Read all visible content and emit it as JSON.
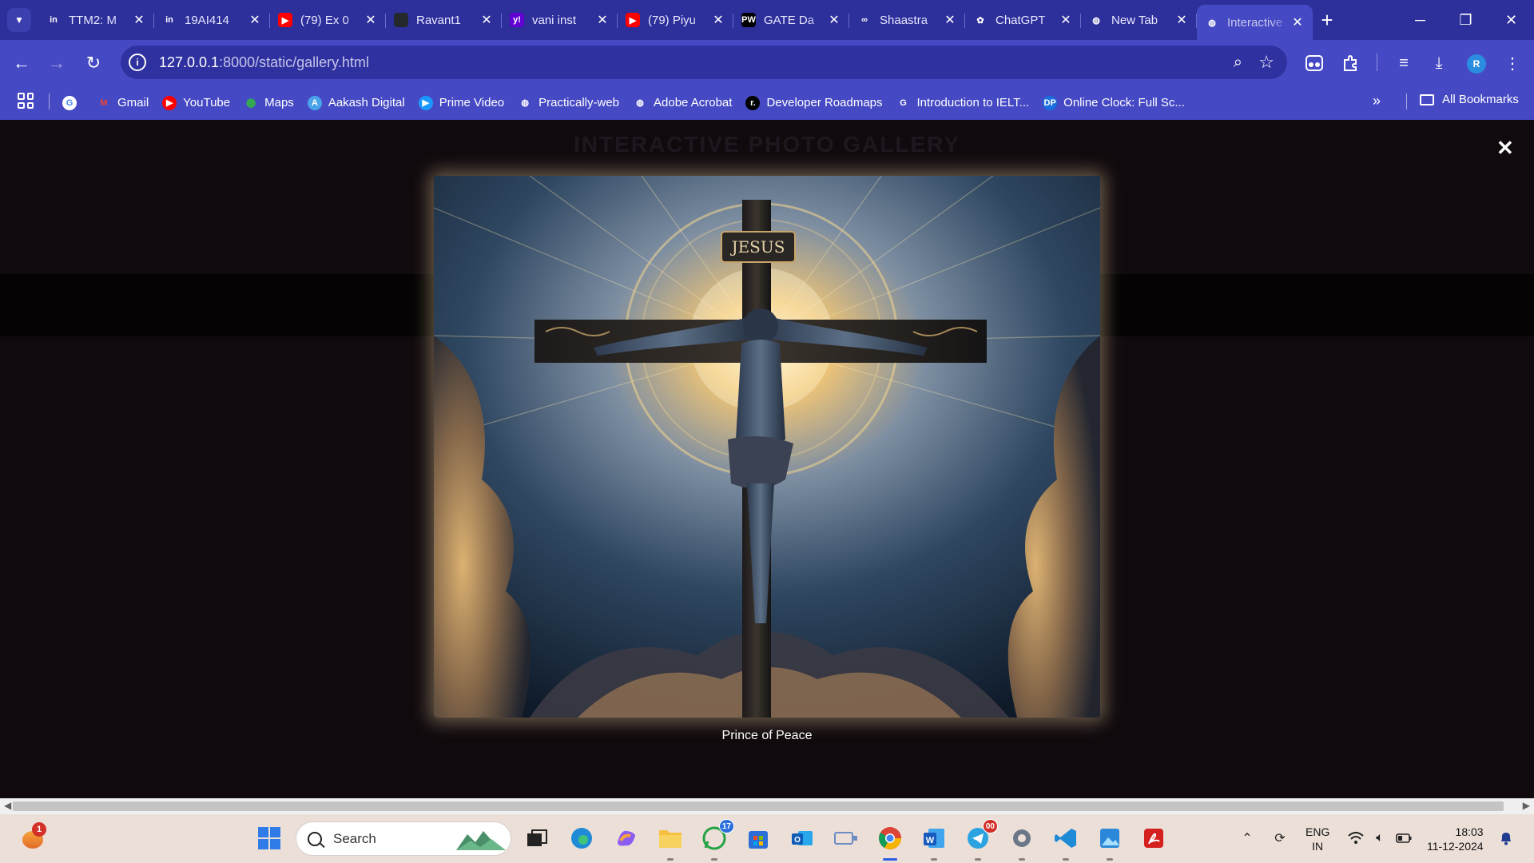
{
  "browser": {
    "tabs": [
      {
        "title": "TTM2: M",
        "favicon": "unstop-icon",
        "favicon_text": "in",
        "favicon_color": "#2d2f9a",
        "active": false
      },
      {
        "title": "19AI414",
        "favicon": "unstop-icon",
        "favicon_text": "in",
        "favicon_color": "#2d2f9a",
        "active": false
      },
      {
        "title": "(79) Ex 0",
        "favicon": "youtube-icon",
        "favicon_text": "▶",
        "favicon_color": "#ff0000",
        "active": false
      },
      {
        "title": "Ravant1",
        "favicon": "github-icon",
        "favicon_text": "",
        "favicon_color": "#24292e",
        "active": false
      },
      {
        "title": "vani inst",
        "favicon": "yahoo-icon",
        "favicon_text": "y!",
        "favicon_color": "#6001d2",
        "active": false
      },
      {
        "title": "(79) Piyu",
        "favicon": "youtube-icon",
        "favicon_text": "▶",
        "favicon_color": "#ff0000",
        "active": false
      },
      {
        "title": "GATE Da",
        "favicon": "pw-icon",
        "favicon_text": "PW",
        "favicon_color": "#000000",
        "active": false
      },
      {
        "title": "Shaastra",
        "favicon": "shaastra-icon",
        "favicon_text": "∞",
        "favicon_color": "#2d2f9a",
        "active": false
      },
      {
        "title": "ChatGPT",
        "favicon": "chatgpt-icon",
        "favicon_text": "✿",
        "favicon_color": "#2d2f9a",
        "active": false
      },
      {
        "title": "New Tab",
        "favicon": "globe-icon",
        "favicon_text": "◍",
        "favicon_color": "#2d2f9a",
        "active": false
      },
      {
        "title": "Interactive",
        "favicon": "globe-icon",
        "favicon_text": "◍",
        "favicon_color": "#4649c4",
        "active": true
      }
    ],
    "url_host": "127.0.0.1",
    "url_rest": ":8000/static/gallery.html",
    "bookmarks": [
      {
        "label": "",
        "icon": "google-icon",
        "icon_text": "G",
        "icon_color": "#ffffff",
        "text_color": "#4285f4"
      },
      {
        "label": "Gmail",
        "icon": "gmail-icon",
        "icon_text": "M",
        "icon_color": "transparent",
        "text_color": "#ea4335"
      },
      {
        "label": "YouTube",
        "icon": "youtube-icon",
        "icon_text": "▶",
        "icon_color": "#ff0000",
        "text_color": "#ffffff"
      },
      {
        "label": "Maps",
        "icon": "maps-icon",
        "icon_text": "⬤",
        "icon_color": "transparent",
        "text_color": "#34a853"
      },
      {
        "label": "Aakash Digital",
        "icon": "aakash-icon",
        "icon_text": "A",
        "icon_color": "#4aa3e8",
        "text_color": "#ffffff"
      },
      {
        "label": "Prime Video",
        "icon": "prime-video-icon",
        "icon_text": "▶",
        "icon_color": "#1a98ff",
        "text_color": "#ffffff"
      },
      {
        "label": "Practically-web",
        "icon": "globe-icon",
        "icon_text": "◍",
        "icon_color": "transparent",
        "text_color": "#ffffff"
      },
      {
        "label": "Adobe Acrobat",
        "icon": "globe-icon",
        "icon_text": "◍",
        "icon_color": "transparent",
        "text_color": "#ffffff"
      },
      {
        "label": "Developer Roadmaps",
        "icon": "roadmap-icon",
        "icon_text": "r.",
        "icon_color": "#000000",
        "text_color": "#ffffff"
      },
      {
        "label": "Introduction to IELT...",
        "icon": "google-icon",
        "icon_text": "G",
        "icon_color": "transparent",
        "text_color": "#ffffff"
      },
      {
        "label": "Online Clock: Full Sc...",
        "icon": "dp-icon",
        "icon_text": "DP",
        "icon_color": "#1a6fe0",
        "text_color": "#ffffff"
      }
    ],
    "all_bookmarks_label": "All Bookmarks",
    "profile_initial": "R"
  },
  "page": {
    "title": "INTERACTIVE PHOTO GALLERY",
    "close_symbol": "✕",
    "image_label": "JESUS",
    "caption": "Prince of Peace"
  },
  "taskbar": {
    "weather_badge": "1",
    "search_label": "Search",
    "whatsapp_badge": "17",
    "telegram_badge": "00",
    "lang_line1": "ENG",
    "lang_line2": "IN",
    "time": "18:03",
    "date": "11-12-2024"
  }
}
